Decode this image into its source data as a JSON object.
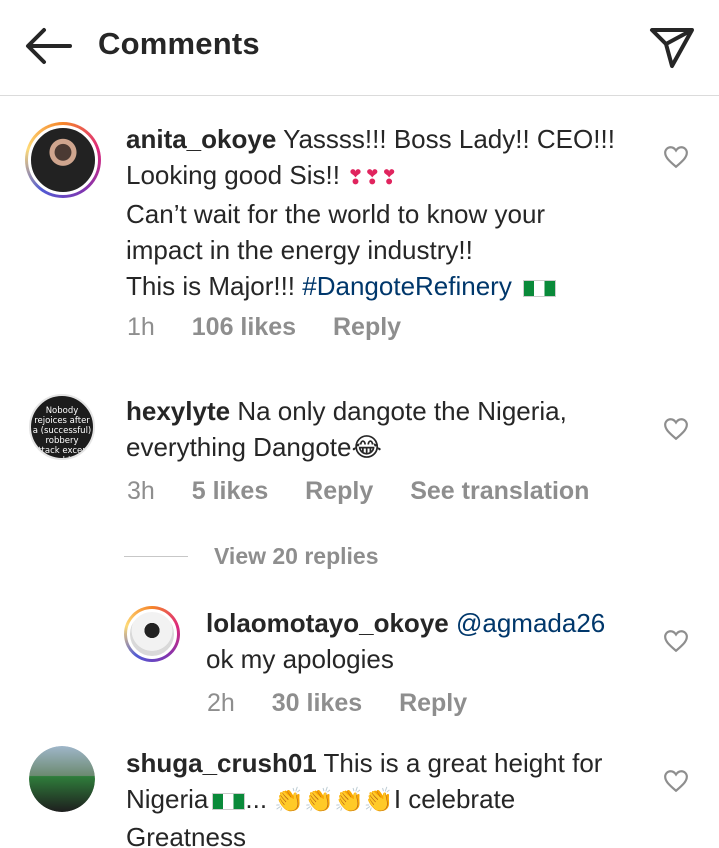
{
  "header": {
    "title": "Comments",
    "back_icon": "arrow-left-icon",
    "send_icon": "paper-plane-icon"
  },
  "comments": [
    {
      "username": "anita_okoye",
      "lines": [
        "Yassss!!! Boss Lady!! CEO!!!",
        "Looking good Sis!!",
        "Can’t wait for the world to know your",
        "impact in the energy industry!!",
        "This is Major!!!"
      ],
      "hashtag": "#DangoteRefinery",
      "hearts_emoji": "❣❣❣",
      "time": "1h",
      "likes": "106 likes",
      "reply": "Reply"
    },
    {
      "username": "hexylyte",
      "avatar_text": "Nobody rejoices after a (successful) robbery attack except the robbers",
      "lines": [
        "Na only dangote the Nigeria,",
        "everything Dangote"
      ],
      "emoji": "😂",
      "time": "3h",
      "likes": "5 likes",
      "reply": "Reply",
      "translate": "See translation"
    },
    {
      "username": "lolaomotayo_okoye",
      "mention": "@agmada26",
      "lines": [
        "ok my apologies"
      ],
      "time": "2h",
      "likes": "30 likes",
      "reply": "Reply"
    },
    {
      "username": "shuga_crush01",
      "lines": [
        "This is a great height for",
        "Nigeria",
        "...",
        "I celebrate",
        "Greatness"
      ],
      "emoji": "👏👏👏👏"
    }
  ],
  "view_replies": "View 20 replies",
  "colors": {
    "link": "#00376b",
    "muted": "#8e8e8e",
    "text": "#262626",
    "divider": "#dbdbdb",
    "flag_green": "#0a8a3a"
  }
}
